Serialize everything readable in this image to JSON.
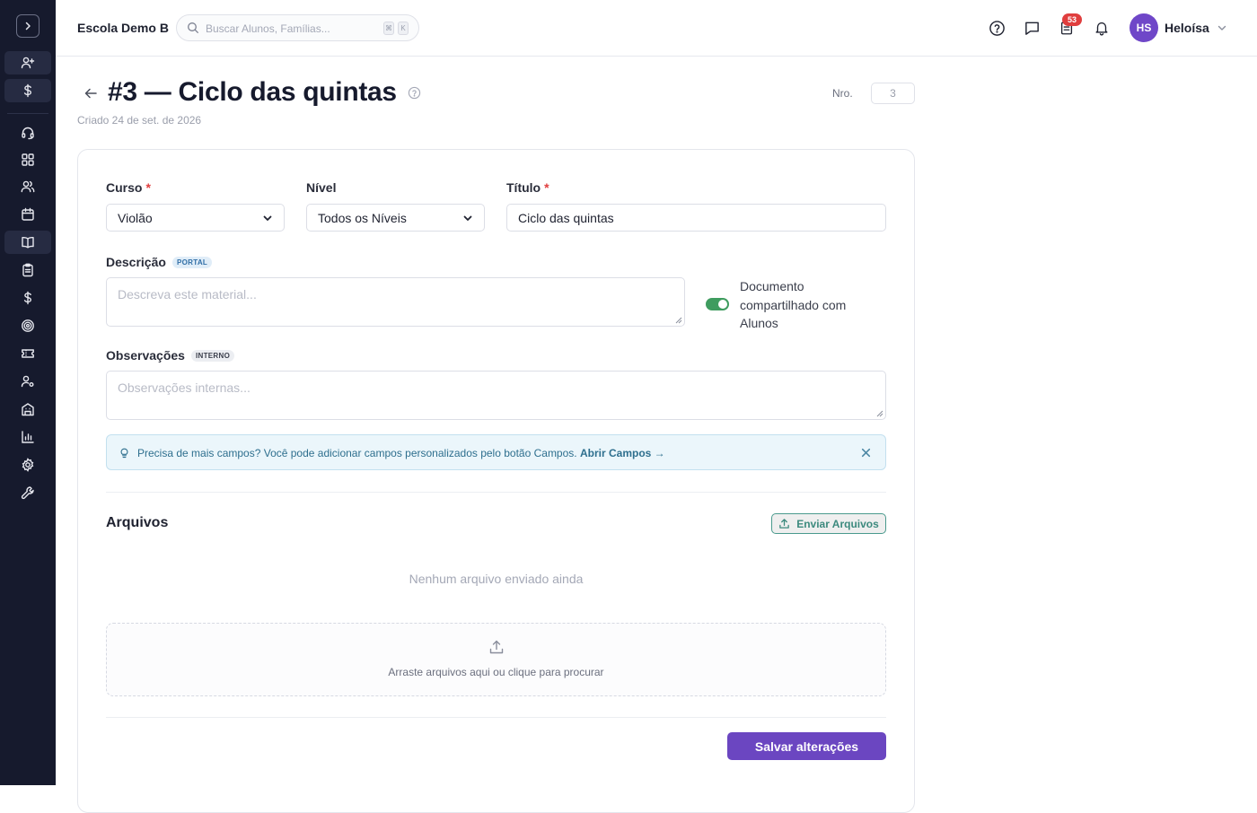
{
  "topbar": {
    "school_name": "Escola Demo B",
    "search_placeholder": "Buscar Alunos, Famílias...",
    "search_kbd_1": "⌘",
    "search_kbd_2": "K",
    "tasks_badge": "53",
    "user_initials": "HS",
    "user_name": "Heloísa"
  },
  "sidebar": {
    "icons": [
      "chevron-right-icon",
      "user-plus-icon",
      "dollar-icon",
      "headset-icon",
      "grid-icon",
      "users-icon",
      "calendar-icon",
      "book-icon",
      "clipboard-icon",
      "dollar-icon",
      "target-icon",
      "ticket-icon",
      "user-cog-icon",
      "building-icon",
      "bar-chart-icon",
      "gear-icon",
      "wrench-icon"
    ],
    "active_icon": "book-icon"
  },
  "page": {
    "title": "#3 — Ciclo das quintas",
    "created": "Criado 24 de set. de 2026",
    "nro_label": "Nro.",
    "nro_value": "3"
  },
  "form": {
    "curso_label": "Curso",
    "curso_value": "Violão",
    "nivel_label": "Nível",
    "nivel_value": "Todos os Níveis",
    "titulo_label": "Título",
    "titulo_value": "Ciclo das quintas",
    "required_mark": "*",
    "descricao_label": "Descrição",
    "descricao_tag": "PORTAL",
    "descricao_placeholder": "Descreva este material...",
    "toggle_label": "Documento compartilhado com Alunos",
    "toggle_on": true,
    "observacoes_label": "Observações",
    "observacoes_tag": "INTERNO",
    "observacoes_placeholder": "Observações internas..."
  },
  "info": {
    "message": "Precisa de mais campos? Você pode adicionar campos personalizados pelo botão Campos.",
    "link": "Abrir Campos →"
  },
  "files": {
    "title": "Arquivos",
    "upload_label": "Enviar Arquivos",
    "empty_text": "Nenhum arquivo enviado ainda",
    "drop_text": "Arraste arquivos aqui ou clique para procurar"
  },
  "actions": {
    "save_label": "Salvar alterações"
  },
  "colors": {
    "sidebar_bg": "#161a2d",
    "primary": "#6b46c1",
    "teal": "#3d8a7e",
    "toggle_on": "#3f9c5f",
    "badge": "#e03e3e"
  }
}
